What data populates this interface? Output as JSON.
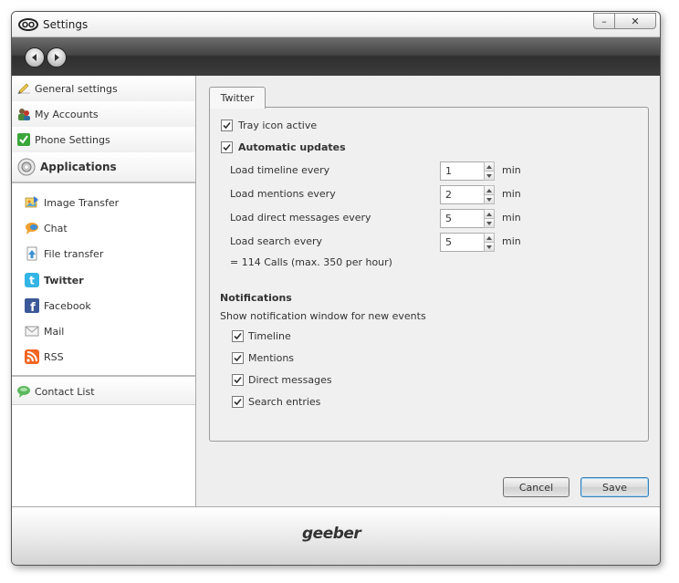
{
  "window": {
    "title": "Settings"
  },
  "sidebar": {
    "categories": [
      {
        "label": "General settings",
        "icon": "pencil-icon"
      },
      {
        "label": "My Accounts",
        "icon": "accounts-icon"
      },
      {
        "label": "Phone Settings",
        "icon": "check-icon"
      },
      {
        "label": "Applications",
        "icon": "applications-icon"
      }
    ],
    "apps": [
      {
        "label": "Image Transfer",
        "icon": "image-transfer-icon"
      },
      {
        "label": "Chat",
        "icon": "chat-icon"
      },
      {
        "label": "File transfer",
        "icon": "file-transfer-icon"
      },
      {
        "label": "Twitter",
        "icon": "twitter-icon"
      },
      {
        "label": "Facebook",
        "icon": "facebook-icon"
      },
      {
        "label": "Mail",
        "icon": "mail-icon"
      },
      {
        "label": "RSS",
        "icon": "rss-icon"
      }
    ],
    "contact_list": {
      "label": "Contact List",
      "icon": "contact-list-icon"
    }
  },
  "main": {
    "tab_label": "Twitter",
    "tray_icon": {
      "label": "Tray icon active",
      "checked": true
    },
    "auto_updates": {
      "label": "Automatic updates",
      "checked": true
    },
    "intervals": [
      {
        "label": "Load timeline every",
        "value": "1",
        "unit": "min"
      },
      {
        "label": "Load mentions every",
        "value": "2",
        "unit": "min"
      },
      {
        "label": "Load direct messages every",
        "value": "5",
        "unit": "min"
      },
      {
        "label": "Load search every",
        "value": "5",
        "unit": "min"
      }
    ],
    "calls_summary": "= 114 Calls (max. 350 per hour)",
    "notifications": {
      "heading": "Notifications",
      "description": "Show notification window for new events",
      "items": [
        {
          "label": "Timeline",
          "checked": true
        },
        {
          "label": "Mentions",
          "checked": true
        },
        {
          "label": "Direct messages",
          "checked": true
        },
        {
          "label": "Search entries",
          "checked": true
        }
      ]
    }
  },
  "buttons": {
    "cancel": "Cancel",
    "save": "Save"
  },
  "footer": {
    "logo_text": "geeber"
  },
  "colors": {
    "twitter": "#33b5e5",
    "facebook": "#3b5998",
    "rss": "#f26522",
    "check": "#3aa63a"
  }
}
